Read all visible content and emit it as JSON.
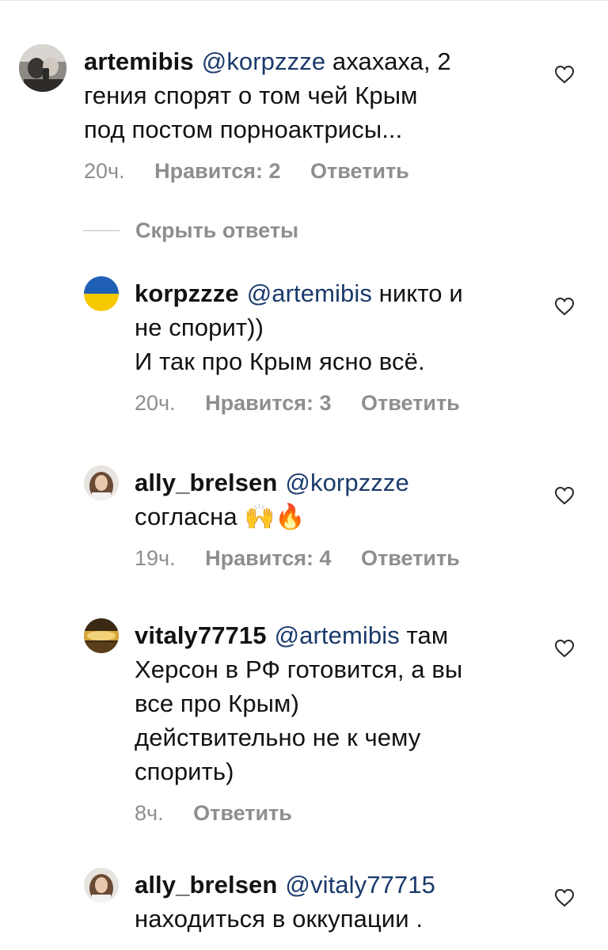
{
  "actions": {
    "reply_label": "Ответить",
    "hide_replies_label": "Скрыть ответы"
  },
  "comments": [
    {
      "username": "artemibis",
      "mention": "@korpzzze",
      "text_lines": [
        "ахахаха, 2",
        "гения спорят о том чей Крым",
        "под постом порноактрисы..."
      ],
      "time": "20ч.",
      "likes": "Нравится: 2"
    },
    {
      "username": "korpzzze",
      "mention": "@artemibis",
      "text_lines": [
        "никто и",
        "не спорит))",
        "И так про Крым ясно всё."
      ],
      "time": "20ч.",
      "likes": "Нравится: 3"
    },
    {
      "username": "ally_brelsen",
      "mention": "@korpzzze",
      "text_lines": [
        "",
        "согласна"
      ],
      "emoji": "🙌🔥",
      "time": "19ч.",
      "likes": "Нравится: 4"
    },
    {
      "username": "vitaly77715",
      "mention": "@artemibis",
      "text_lines": [
        "там",
        "Херсон в РФ готовится, а вы",
        "все про Крым)",
        "действительно не к чему",
        "спорить)"
      ],
      "time": "8ч."
    },
    {
      "username": "ally_brelsen",
      "mention": "@vitaly77715",
      "text_lines": [
        "",
        "находиться в оккупации ."
      ]
    }
  ]
}
